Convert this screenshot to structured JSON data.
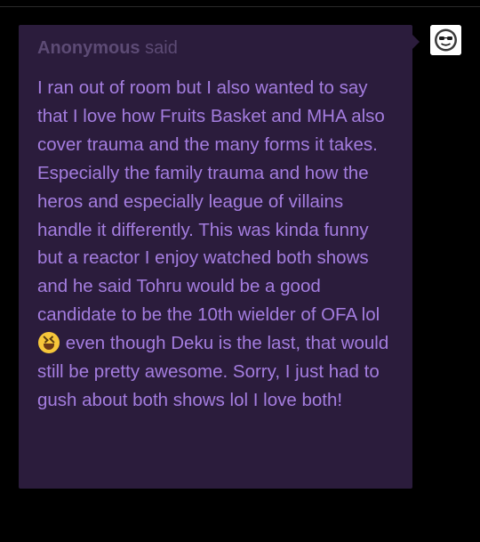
{
  "ask": {
    "asker_name": "Anonymous",
    "said_label": "said",
    "paragraph_before_emoji": "I ran out of room but I also wanted to say that I love how Fruits Basket and MHA also cover trauma and the many forms it takes. Especially the family trauma and how the heros and especially league of villains handle it differently. This was kinda funny but a reactor I enjoy watched both shows and he said Tohru would be a good candidate to be the 10th wielder of OFA lol",
    "emoji_icon": "grinning-squinting-face-icon",
    "paragraph_after_emoji": "even though Deku is the last, that would still be pretty awesome. Sorry, I just had to gush about both shows lol I love both!"
  },
  "avatar": {
    "icon": "anonymous-sunglasses-avatar-icon"
  },
  "colors": {
    "background": "#000000",
    "bubble": "#2b1c3c",
    "asker_text": "#5d4b75",
    "body_text": "#a47ddf"
  }
}
